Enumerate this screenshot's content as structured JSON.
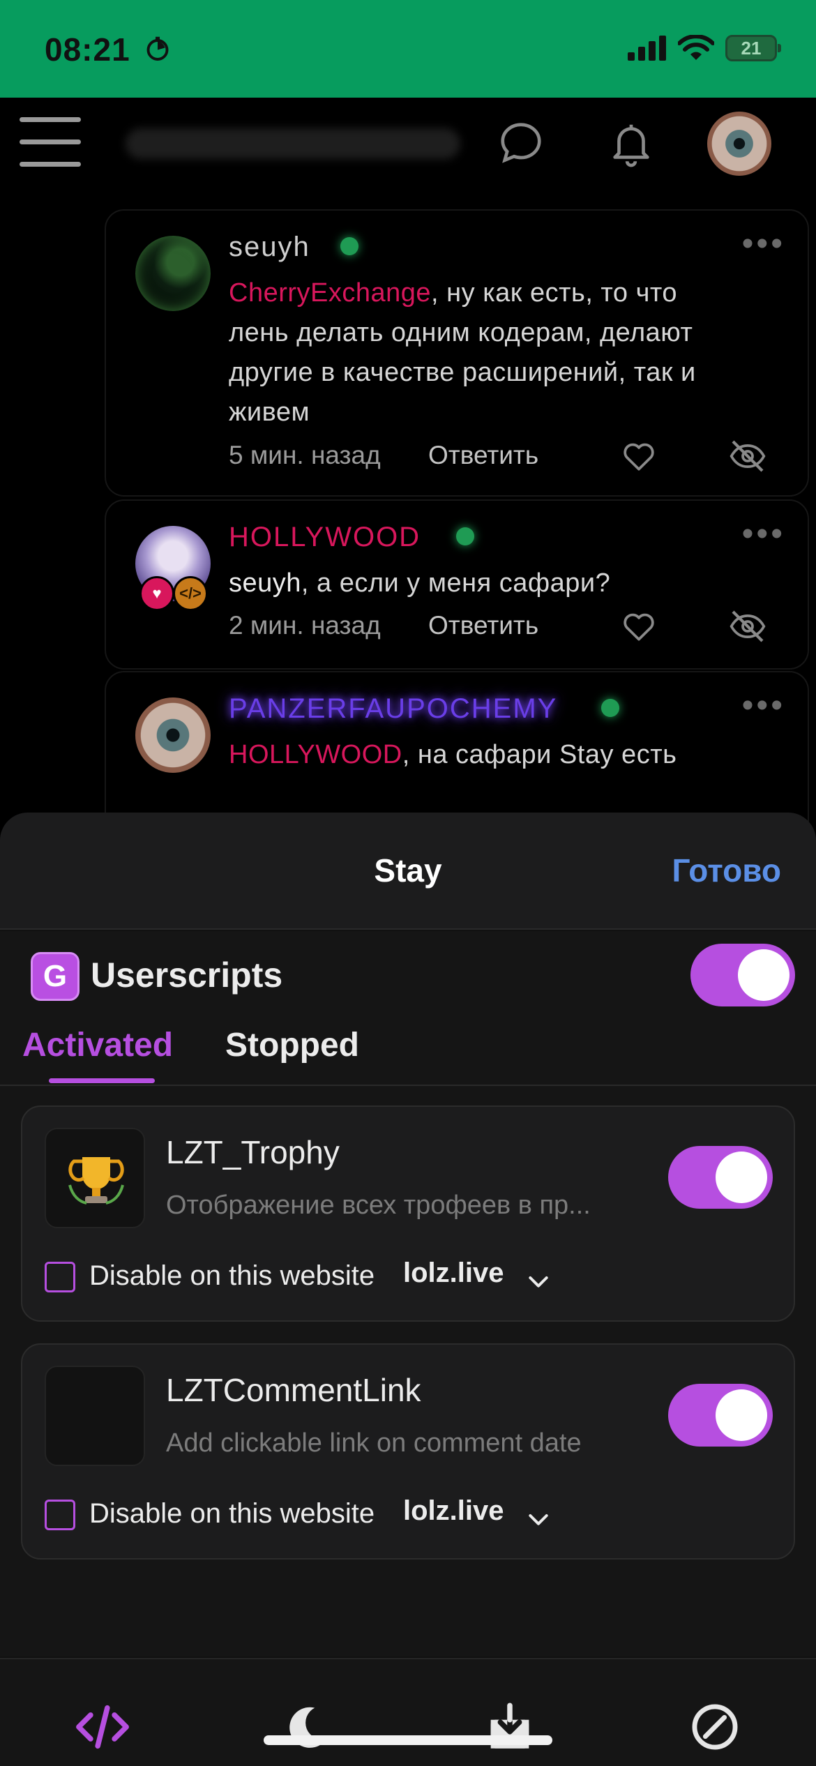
{
  "status_bar": {
    "time": "08:21",
    "battery": "21"
  },
  "forum": {
    "comments": [
      {
        "author": "seuyh",
        "author_color": "#cfcfcf",
        "mention": "CherryExchange",
        "text": ", ну как есть, то что лень делать одним кодерам, делают другие в качестве расширений, так и живем",
        "time": "5 мин. назад",
        "reply_label": "Ответить"
      },
      {
        "author": "HOLLYWOOD",
        "author_color": "#d8175c",
        "mention": "seuyh",
        "text": ", а если у меня сафари?",
        "time": "2 мин. назад",
        "reply_label": "Ответить"
      },
      {
        "author": "PANZERFAUPOCHEMY",
        "author_color": "#6a3ee8",
        "mention": "HOLLYWOOD",
        "text": ", на сафари Stay есть"
      }
    ]
  },
  "sheet": {
    "title": "Stay",
    "done_label": "Готово",
    "section_title": "Userscripts",
    "section_icon_letter": "G",
    "tabs": [
      {
        "label": "Activated",
        "active": true
      },
      {
        "label": "Stopped",
        "active": false
      }
    ],
    "scripts": [
      {
        "name": "LZT_Trophy",
        "description": "Отображение всех трофеев в пр...",
        "enabled": true,
        "disable_label": "Disable on this website",
        "site": "lolz.live"
      },
      {
        "name": "LZTCommentLink",
        "description": "Add clickable link on comment date",
        "enabled": true,
        "disable_label": "Disable on this website",
        "site": "lolz.live"
      }
    ]
  },
  "accent_color": "#b64fe0"
}
